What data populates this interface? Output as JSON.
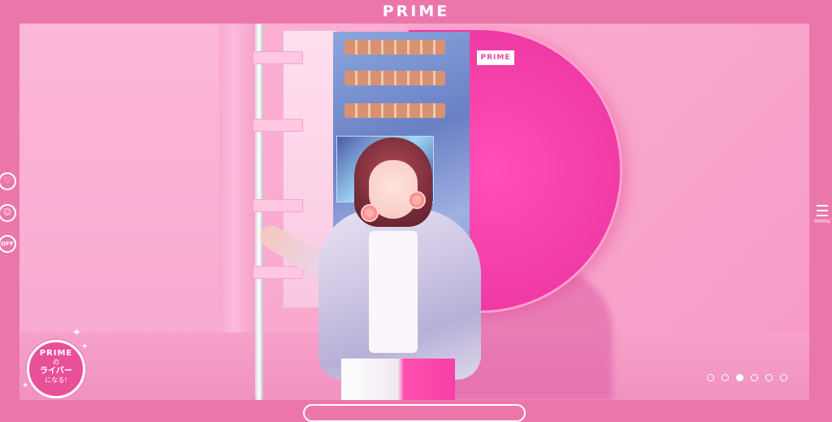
{
  "header": {
    "logo_text": "PRIME"
  },
  "hero": {
    "panel_tag": "PRIME",
    "active_slide": 3,
    "slide_count": 6
  },
  "side_controls": {
    "favorite_icon": "heart-icon",
    "character_icon": "face-icon",
    "sound_toggle_label": "OFF"
  },
  "menu": {
    "label": "menu",
    "icon": "hamburger-icon"
  },
  "badge": {
    "line1": "PRIME",
    "line2": "の",
    "line3": "ライバー",
    "line4": "になる!",
    "sparkle_icon": "sparkle-icon"
  },
  "bottom_bar": {
    "label": ""
  },
  "colors": {
    "frame": "#eb77aa",
    "accent_pink": "#f43fa8",
    "text": "#ffffff"
  }
}
